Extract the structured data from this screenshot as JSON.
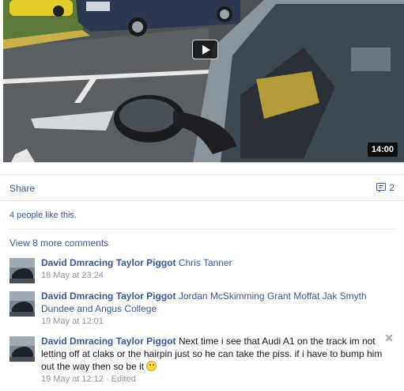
{
  "video": {
    "duration": "14:00",
    "play_icon": "play-icon"
  },
  "actions": {
    "share_label": "Share",
    "comment_count": "2",
    "comment_icon": "comment-icon"
  },
  "likes_text": "4 people like this.",
  "view_more": "View 8 more comments",
  "comments": [
    {
      "author": "David Dmracing Taylor Piggot",
      "tags": "Chris Tanner",
      "text": "",
      "time": "18 May at 23:24"
    },
    {
      "author": "David Dmracing Taylor Piggot",
      "tags": "Jordan McSkimming Grant Moffat Jak Smyth Dundee and Angus College",
      "text": "",
      "time": "19 May at 12:01"
    },
    {
      "author": "David Dmracing Taylor Piggot",
      "tags": "",
      "text": "Next time i see that Audi A1 on the track im not letting off at claks or the hairpin just so he can take the piss. if i have to bump him out the way then so be it",
      "time": "19 May at 12:12 · Edited",
      "remove_icon": "close-icon",
      "remove_glyph": "✕"
    }
  ]
}
